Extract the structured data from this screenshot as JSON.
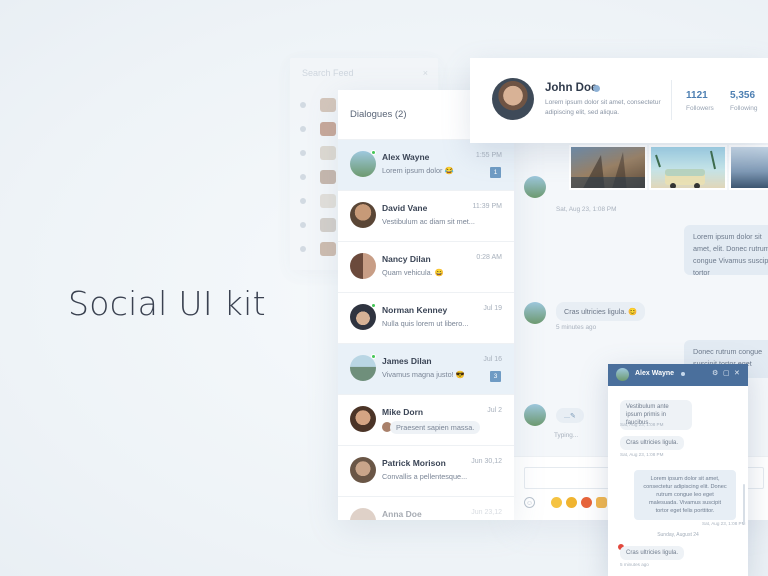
{
  "hero": {
    "title": "Social UI kit"
  },
  "ghost_panel": {
    "search_placeholder": "Search Feed",
    "close": "×"
  },
  "dialogues": {
    "title": "Dialogues (2)",
    "items": [
      {
        "name": "Alex Wayne",
        "time": "1:55 PM",
        "message": "Lorem ipsum dolor 😂",
        "badge": "1",
        "online": true,
        "active": true
      },
      {
        "name": "David Vane",
        "time": "11:39 PM",
        "message": "Vestibulum ac diam sit met...",
        "badge": "",
        "online": false
      },
      {
        "name": "Nancy Dilan",
        "time": "0:28 AM",
        "message": "Quam vehicula. 😄",
        "badge": "",
        "online": false
      },
      {
        "name": "Norman Kenney",
        "time": "Jul 19",
        "message": "Nulla quis lorem ut libero...",
        "badge": "",
        "online": true
      },
      {
        "name": "James Dilan",
        "time": "Jul 16",
        "message": "Vivamus magna justo! 😎",
        "badge": "3",
        "online": true,
        "active": true
      },
      {
        "name": "Mike Dorn",
        "time": "Jul 2",
        "message": "Praesent sapien massa.",
        "badge": "",
        "online": false
      },
      {
        "name": "Patrick Morison",
        "time": "Jun 30,12",
        "message": "Convallis a pellentesque...",
        "badge": "",
        "online": false
      },
      {
        "name": "Anna Doe",
        "time": "Jun 23,12",
        "message": "",
        "badge": "",
        "online": false
      }
    ]
  },
  "conversation": {
    "photo_time": "Sat, Aug 23, 1:08 PM",
    "out_message_1": "Lorem ipsum dolor sit amet, elit. Donec rutrum congue Vivamus suscipit tortor",
    "in_message": "Cras ultricies ligula. 😊",
    "in_time": "5 minutes ago",
    "out_message_2": "Donec rutrum congue suscipit tortor eget",
    "typing": "Typing...",
    "typing_bubble": "...✎"
  },
  "profile": {
    "name": "John Doe",
    "bio": "Lorem ipsum dolor sit amet, consectetur adipiscing elit, sed aliqua.",
    "followers_count": "1121",
    "followers_label": "Followers",
    "following_count": "5,356",
    "following_label": "Following"
  },
  "popup": {
    "name": "Alex Wayne",
    "controls": [
      "⚙",
      "▢",
      "✕"
    ],
    "msg1": "Vestibulum ante ipsum primis in faucibus.",
    "time1": "Sat, Aug 23, 1:08 PM",
    "msg2": "Cras ultricies ligula.",
    "time2": "Sat, Aug 23, 1:08 PM",
    "msg3": "Lorem ipsum dolor sit amet, consectetur adipiscing elit. Donec rutrum congue leo eget malesuada. Vivamus suscipit tortor eget felis porttitor.",
    "time3": "Sat, Aug 23, 1:08 PM",
    "separator": "Sunday, August 24",
    "msg4": "Cras ultricies ligula.",
    "time4": "5 minutes ago"
  },
  "colors": {
    "accent": "#4a6f9c",
    "online": "#45c657",
    "badge": "#6f9bc4",
    "error": "#e2483d"
  }
}
